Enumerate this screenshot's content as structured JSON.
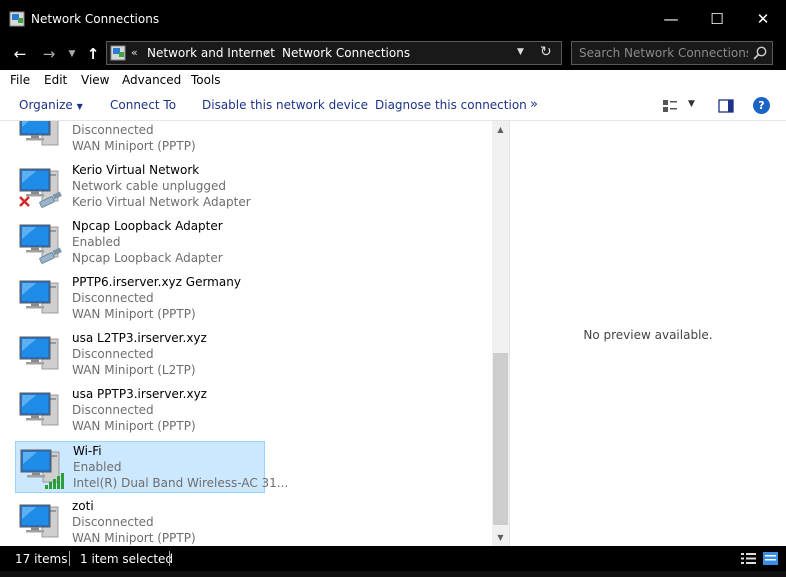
{
  "window": {
    "title": "Network Connections"
  },
  "address": {
    "crumbs": [
      "Network and Internet",
      "Network Connections"
    ],
    "overflow_chevron": "«"
  },
  "search": {
    "placeholder": "Search Network Connections"
  },
  "menu": [
    "File",
    "Edit",
    "View",
    "Advanced",
    "Tools"
  ],
  "commands": {
    "organize": "Organize",
    "connect_to": "Connect To",
    "disable": "Disable this network device",
    "diagnose": "Diagnose this connection",
    "more": "»"
  },
  "connections": [
    {
      "name": "",
      "status": "Disconnected",
      "device": "WAN Miniport (PPTP)",
      "badge": "none"
    },
    {
      "name": "Kerio Virtual Network",
      "status": "Network cable unplugged",
      "device": "Kerio Virtual Network Adapter",
      "badge": "red-x"
    },
    {
      "name": "Npcap Loopback Adapter",
      "status": "Enabled",
      "device": "Npcap Loopback Adapter",
      "badge": "cable"
    },
    {
      "name": "PPTP6.irserver.xyz Germany",
      "status": "Disconnected",
      "device": "WAN Miniport (PPTP)",
      "badge": "none"
    },
    {
      "name": "usa L2TP3.irserver.xyz",
      "status": "Disconnected",
      "device": "WAN Miniport (L2TP)",
      "badge": "none"
    },
    {
      "name": "usa PPTP3.irserver.xyz",
      "status": "Disconnected",
      "device": "WAN Miniport (PPTP)",
      "badge": "none"
    },
    {
      "name": "Wi-Fi",
      "status": "Enabled",
      "device": "Intel(R) Dual Band Wireless-AC 31...",
      "badge": "signal",
      "selected": true
    },
    {
      "name": "zoti",
      "status": "Disconnected",
      "device": "WAN Miniport (PPTP)",
      "badge": "none"
    }
  ],
  "preview": {
    "text": "No preview available."
  },
  "status": {
    "item_count": "17 items",
    "selection": "1 item selected"
  }
}
